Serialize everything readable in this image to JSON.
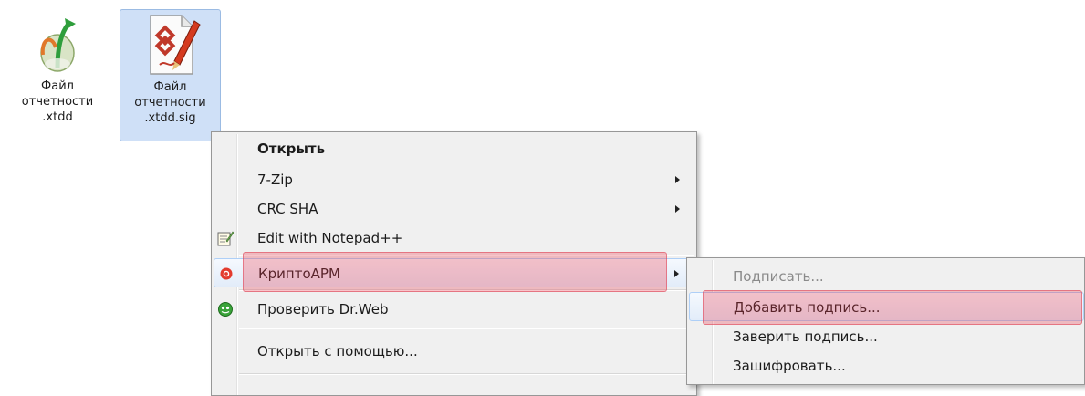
{
  "desktop": {
    "icons": [
      {
        "label": "Файл\nотчетности\n.xtdd",
        "icon": "xtdd-file-icon"
      },
      {
        "label": "Файл\nотчетности\n.xtdd.sig",
        "icon": "signed-document-icon"
      }
    ]
  },
  "context_menu": {
    "items": [
      {
        "label": "Открыть",
        "bold": true
      },
      {
        "label": "7-Zip",
        "submenu": true
      },
      {
        "label": "CRC SHA",
        "submenu": true
      },
      {
        "label": "Edit with Notepad++",
        "icon": "notepad-icon"
      },
      {
        "label": "КриптоАРМ",
        "icon": "cryptoarm-icon",
        "submenu": true,
        "highlighted": true
      },
      {
        "label": "Проверить Dr.Web",
        "icon": "drweb-icon"
      },
      {
        "label": "Открыть с помощью..."
      }
    ]
  },
  "submenu": {
    "items": [
      {
        "label": "Подписать...",
        "disabled": true
      },
      {
        "label": "Добавить подпись...",
        "highlighted": true
      },
      {
        "label": "Заверить подпись..."
      },
      {
        "label": "Зашифровать..."
      }
    ]
  },
  "colors": {
    "selection": "#cfe0f7",
    "highlight": "#eb3c50",
    "menu_bg": "#f0f0f0"
  }
}
